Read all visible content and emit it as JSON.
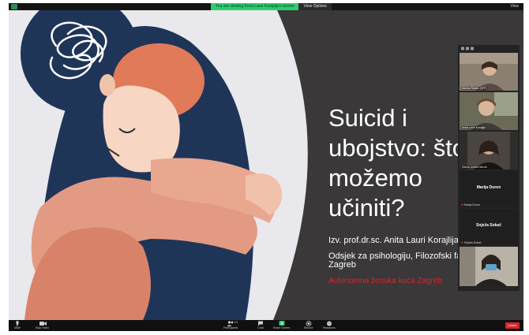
{
  "share_banner": {
    "text": "You are viewing Kuća Lauri Korajlija's screen",
    "options_label": "View Options"
  },
  "top_right": {
    "view_label": "View"
  },
  "slide": {
    "title": "Suicid i\nubojstvo: što\nmožemo\nučiniti?",
    "author": "Izv. prof.dr.sc. Anita Lauri Korajlija",
    "department": "Odsjek za psihologiju, Filozofski fakultet\nZagreb",
    "organization": "Autonomna ženska kuća Zagreb"
  },
  "gallery": {
    "tiles": [
      {
        "type": "video",
        "name": "Marina Šutalo (HRT)"
      },
      {
        "type": "video",
        "name": "Anita Lauri Korajlija"
      },
      {
        "type": "video",
        "name": "Zorica Jovičić Mrvoš"
      },
      {
        "type": "text",
        "title": "Marija Duron",
        "name": "Marija Duron"
      },
      {
        "type": "text",
        "title": "Snježa Sokač",
        "name": "Snježa Sokač"
      },
      {
        "type": "video",
        "name": ""
      }
    ]
  },
  "toolbar": {
    "mute_label": "Mute",
    "video_label": "Stop Video",
    "participants_label": "Participants",
    "participants_count": "21",
    "chat_label": "Chat",
    "share_label": "Share Screen",
    "record_label": "Record",
    "reactions_label": "Reactions",
    "leave_label": "Leave"
  },
  "colors": {
    "slide_bg": "#3a3839",
    "share_green": "#2ecc71",
    "org_red": "#d9262b",
    "leave_red": "#d9262b"
  }
}
